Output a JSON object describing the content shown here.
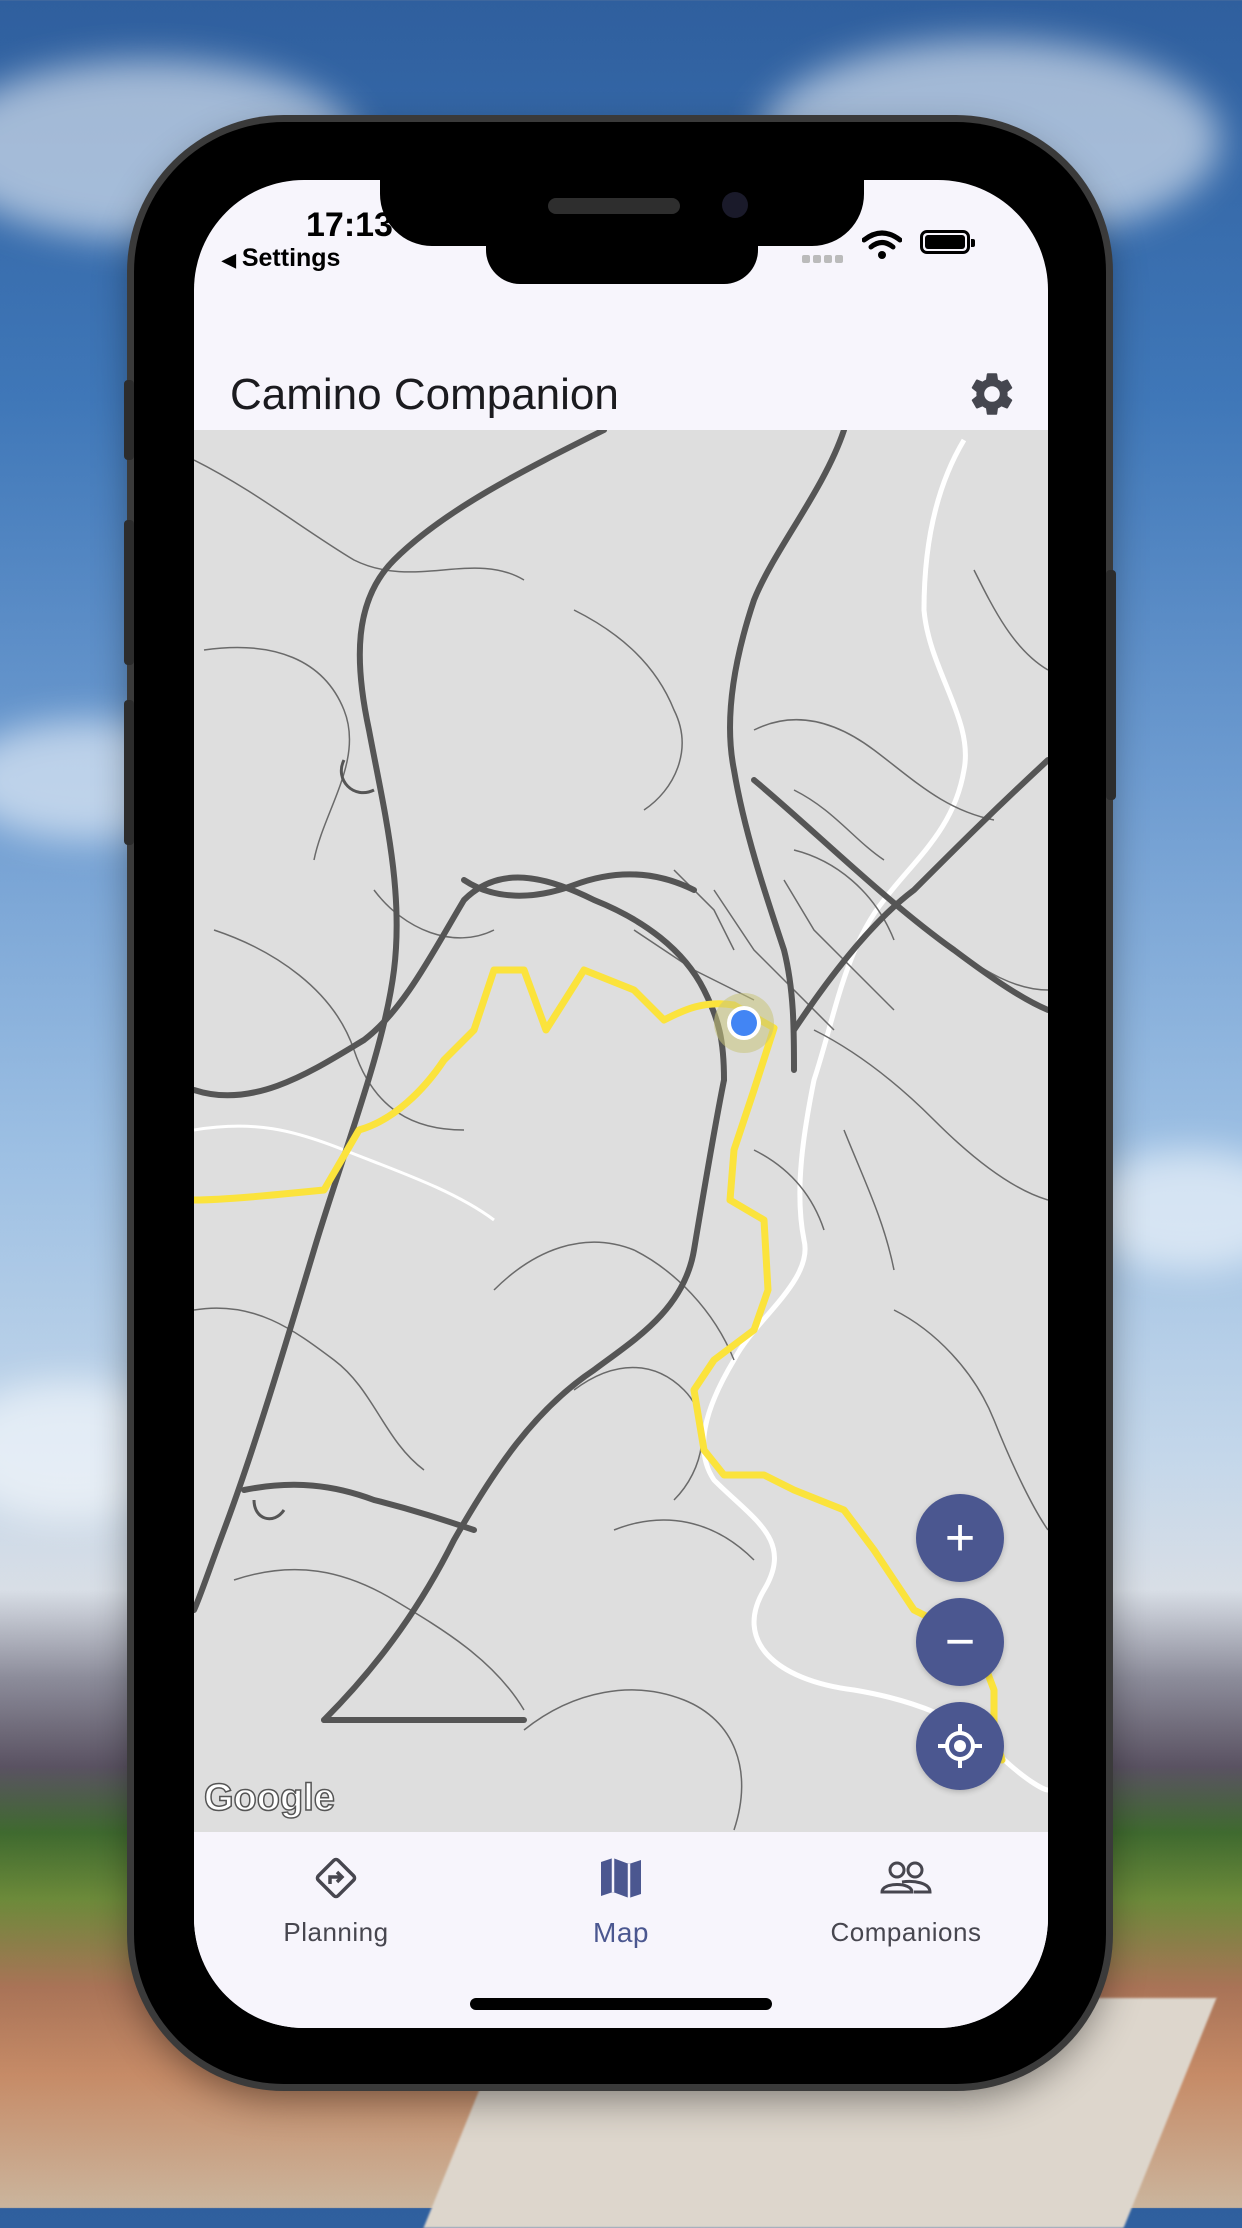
{
  "status_bar": {
    "time": "17:13",
    "back_label": "Settings",
    "back_arrow": "◀"
  },
  "app_bar": {
    "title": "Camino Companion",
    "settings_icon": "gear-icon"
  },
  "map": {
    "attribution": "Google",
    "route_color": "#fbe33c",
    "location_dot_color": "#4285f4",
    "controls": {
      "zoom_in": "+",
      "zoom_out": "−"
    }
  },
  "bottom_nav": {
    "items": [
      {
        "label": "Planning",
        "icon": "directions-sign-icon",
        "active": false
      },
      {
        "label": "Map",
        "icon": "map-icon",
        "active": true
      },
      {
        "label": "Companions",
        "icon": "people-icon",
        "active": false
      }
    ]
  },
  "colors": {
    "primary": "#4b5790",
    "surface": "#f7f5fc",
    "map_background": "#dedede",
    "road_dark": "#555555"
  }
}
